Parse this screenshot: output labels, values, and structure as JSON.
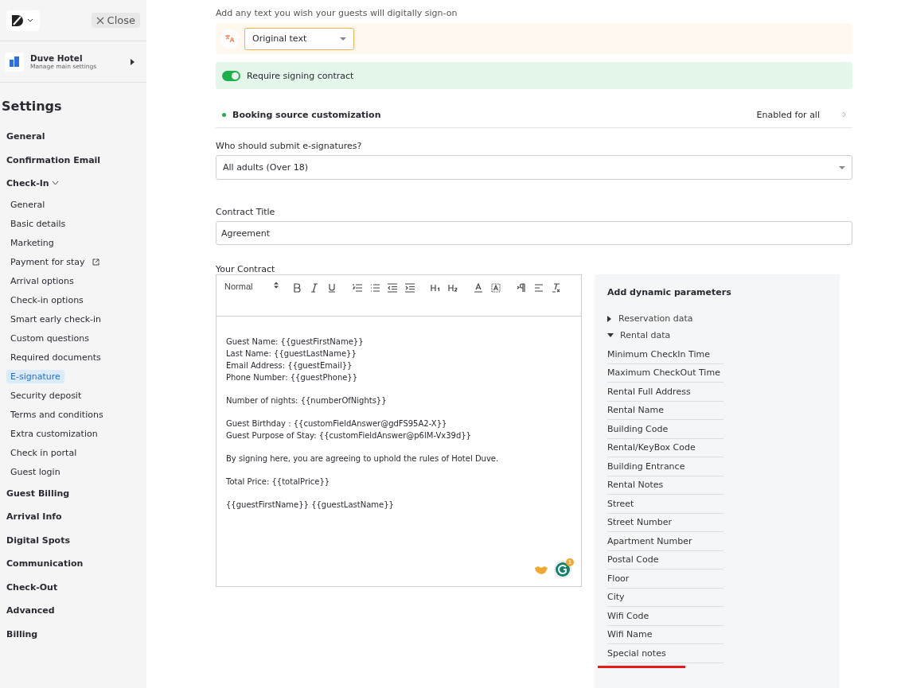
{
  "sidebar": {
    "close": "Close",
    "hotel": {
      "name": "Duve Hotel",
      "subtitle": "Manage main settings"
    },
    "heading": "Settings",
    "items": [
      {
        "label": "General"
      },
      {
        "label": "Confirmation Email"
      },
      {
        "label": "Check-In",
        "expanded": true,
        "children": [
          {
            "label": "General",
            "selected": false
          },
          {
            "label": "Basic details",
            "selected": false
          },
          {
            "label": "Marketing",
            "selected": false
          },
          {
            "label": "Payment for stay",
            "selected": false,
            "external": true
          },
          {
            "label": "Arrival options",
            "selected": false
          },
          {
            "label": "Check-in options",
            "selected": false
          },
          {
            "label": "Smart early check-in",
            "selected": false
          },
          {
            "label": "Custom questions",
            "selected": false
          },
          {
            "label": "Required documents",
            "selected": false
          },
          {
            "label": "E-signature",
            "selected": true
          },
          {
            "label": "Security deposit",
            "selected": false
          },
          {
            "label": "Terms and conditions",
            "selected": false
          },
          {
            "label": "Extra customization",
            "selected": false
          },
          {
            "label": "Check in portal",
            "selected": false
          },
          {
            "label": "Guest login",
            "selected": false
          }
        ]
      },
      {
        "label": "Guest Billing"
      },
      {
        "label": "Arrival Info"
      },
      {
        "label": "Digital Spots"
      },
      {
        "label": "Communication"
      },
      {
        "label": "Check-Out"
      },
      {
        "label": "Advanced"
      },
      {
        "label": "Billing"
      }
    ]
  },
  "main": {
    "subtitle": "Add any text you wish your guests will digitally sign-on",
    "language": {
      "value": "Original text"
    },
    "require_signing": {
      "label": "Require signing contract",
      "on": true
    },
    "booking_source": {
      "label": "Booking source customization",
      "status": "Enabled for all"
    },
    "submitters": {
      "label": "Who should submit e-signatures?",
      "value": "All adults (Over 18)"
    },
    "contract_title": {
      "label": "Contract Title",
      "value": "Agreement"
    },
    "contract": {
      "label": "Your Contract",
      "format": "Normal",
      "grammar_badge": "1",
      "paragraphs": [
        [
          "Guest Name: {{guestFirstName}}",
          "Last Name: {{guestLastName}}",
          "Email Address: {{guestEmail}}",
          "Phone Number: {{guestPhone}}"
        ],
        [
          "Number of nights: {{numberOfNights}}"
        ],
        [
          "Guest Birthday : {{customFieldAnswer@gdFS95A2-X}}",
          "Guest Purpose of Stay: {{customFieldAnswer@p6lM-Vx39d}}"
        ],
        [
          "By signing here, you are agreeing to uphold the rules of Hotel Duve."
        ],
        [
          "Total Price: {{totalPrice}}"
        ],
        [
          "{{guestFirstName}} {{guestLastName}}"
        ]
      ]
    },
    "parameters": {
      "title": "Add dynamic parameters",
      "groups": [
        {
          "label": "Reservation data",
          "expanded": false
        },
        {
          "label": "Rental data",
          "expanded": true,
          "items": [
            "Minimum CheckIn Time",
            "Maximum CheckOut Time",
            "Rental Full Address",
            "Rental Name",
            "Building Code",
            "Rental/KeyBox Code",
            "Building Entrance",
            "Rental Notes",
            "Street",
            "Street Number",
            "Apartment Number",
            "Postal Code",
            "Floor",
            "City",
            "Wifi Code",
            "Wifi Name",
            "Special notes"
          ]
        }
      ]
    }
  }
}
